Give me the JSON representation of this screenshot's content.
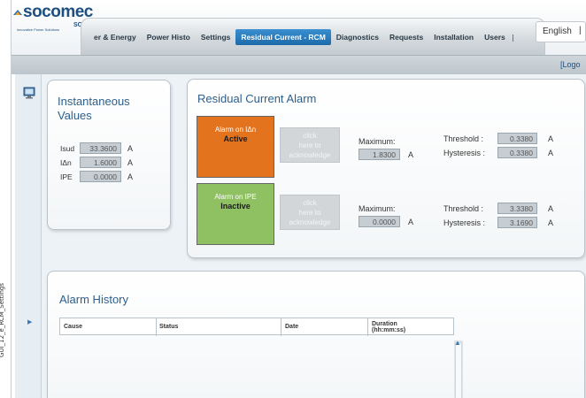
{
  "side_caption": "GUI_12_e_RCM_Settings",
  "logo": {
    "brand": "socomec",
    "sub": "SCP",
    "tagline": "innovative Power Solutions"
  },
  "nav": {
    "items": [
      "er & Energy",
      "Power Histo",
      "Settings",
      "Residual Current - RCM",
      "Diagnostics",
      "Requests",
      "Installation",
      "Users"
    ],
    "active_index": 3,
    "language": "English"
  },
  "logout_text": "[Logo",
  "instantaneous": {
    "title_line1": "Instantaneous",
    "title_line2": "Values",
    "rows": [
      {
        "label": "Isud",
        "value": "33.3600",
        "unit": "A"
      },
      {
        "label": "IΔn",
        "value": "1.6000",
        "unit": "A"
      },
      {
        "label": "IPE",
        "value": "0.0000",
        "unit": "A"
      }
    ]
  },
  "rca": {
    "title": "Residual Current Alarm",
    "alarms": [
      {
        "name": "Alarm on IΔn",
        "state": "Active",
        "color": "#e4731d",
        "ack_line1": "click",
        "ack_line2": "here to",
        "ack_line3": "acknowledge",
        "max_label": "Maximum:",
        "max_value": "1.8300",
        "max_unit": "A",
        "threshold_label": "Threshold :",
        "threshold_value": "0.3380",
        "threshold_unit": "A",
        "hyst_label": "Hysteresis :",
        "hyst_value": "0.3380",
        "hyst_unit": "A"
      },
      {
        "name": "Alarm on IPE",
        "state": "Inactive",
        "color": "#8fc163",
        "ack_line1": "click",
        "ack_line2": "here to",
        "ack_line3": "acknowledge",
        "max_label": "Maximum:",
        "max_value": "0.0000",
        "max_unit": "A",
        "threshold_label": "Threshold :",
        "threshold_value": "3.3380",
        "threshold_unit": "A",
        "hyst_label": "Hysteresis :",
        "hyst_value": "3.1690",
        "hyst_unit": "A"
      }
    ]
  },
  "history": {
    "title": "Alarm History",
    "columns": [
      "Cause",
      "Status",
      "Date",
      "Duration",
      "(hh:mm:ss)"
    ]
  },
  "colors": {
    "accent": "#2c5f8d",
    "active_tab": "#1c6aa9"
  }
}
